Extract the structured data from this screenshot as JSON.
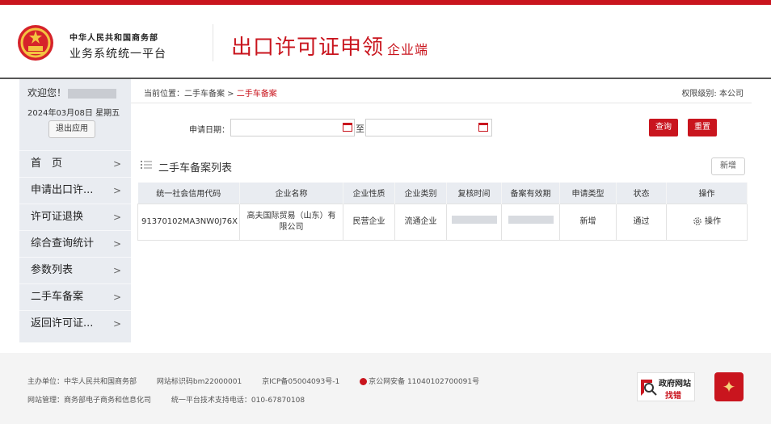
{
  "header": {
    "org_line1": "中华人民共和国商务部",
    "org_line2": "业务系统统一平台",
    "app_title": "出口许可证申领",
    "app_subtitle": "企业端"
  },
  "sidebar": {
    "welcome": "欢迎您！",
    "date": "2024年03月08日 星期五",
    "logout_label": "退出应用",
    "menu": [
      {
        "label": "首　页"
      },
      {
        "label": "申请出口许..."
      },
      {
        "label": "许可证退换"
      },
      {
        "label": "综合查询统计"
      },
      {
        "label": "参数列表"
      },
      {
        "label": "二手车备案"
      },
      {
        "label": "返回许可证..."
      }
    ],
    "chevron": ">"
  },
  "breadcrumb": {
    "prefix": "当前位置：",
    "item1": "二手车备案",
    "sep": " > ",
    "current": "二手车备案"
  },
  "permission": "权限级别: 本公司",
  "filter": {
    "date_label": "申请日期：",
    "to_label": "至",
    "start_value": "",
    "end_value": "",
    "query_label": "查询",
    "reset_label": "重置"
  },
  "list": {
    "title": "二手车备案列表",
    "add_label": "新增",
    "columns": [
      "统一社会信用代码",
      "企业名称",
      "企业性质",
      "企业类别",
      "复核时间",
      "备案有效期",
      "申请类型",
      "状态",
      "操作"
    ],
    "rows": [
      {
        "credit_code": "91370102MA3NW0J76X",
        "company": "高夫国际贸易（山东）有限公司",
        "nature": "民营企业",
        "category": "流通企业",
        "apply_type": "新增",
        "status": "通过",
        "action": "操作"
      }
    ]
  },
  "footer": {
    "sponsor": "主办单位：中华人民共和国商务部",
    "site_id": "网站标识码bm22000001",
    "icp": "京ICP备05004093号-1",
    "police": "京公网安备 11040102700091号",
    "manager": "网站管理：商务部电子商务和信息化司",
    "support": "统一平台技术支持电话：010-67870108",
    "gov_badge_line1": "政府网站",
    "gov_badge_line2": "找错"
  },
  "colors": {
    "brand_red": "#c9151e",
    "sidebar_bg": "#e9ecf1",
    "footer_bg": "#f4f4f4"
  },
  "icons": [
    "national-emblem-icon",
    "calendar-icon",
    "list-icon",
    "gear-icon",
    "police-badge-icon",
    "search-icon",
    "party-emblem-icon"
  ]
}
